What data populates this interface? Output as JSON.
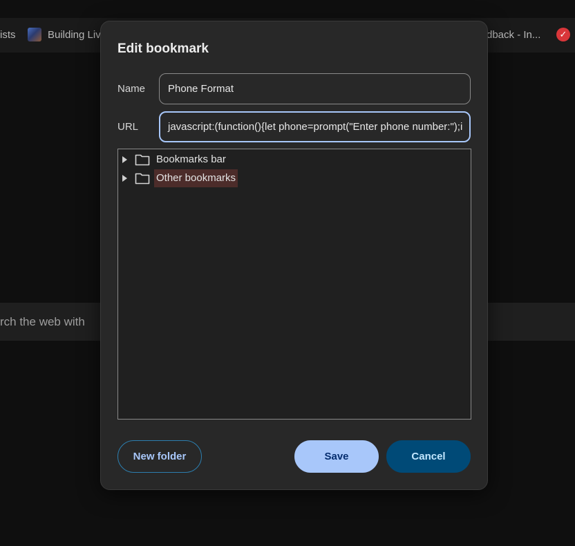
{
  "background": {
    "bookmarks_bar": {
      "items": [
        "ists",
        "Building Liv",
        "dback - In..."
      ]
    },
    "search_placeholder": "rch the web with"
  },
  "dialog": {
    "title": "Edit bookmark",
    "name_label": "Name",
    "name_value": "Phone Format",
    "url_label": "URL",
    "url_value": "javascript:(function(){let phone=prompt(\"Enter phone number:\");i",
    "folders": [
      {
        "label": "Bookmarks bar",
        "selected": false
      },
      {
        "label": "Other bookmarks",
        "selected": true
      }
    ],
    "buttons": {
      "new_folder": "New folder",
      "save": "Save",
      "cancel": "Cancel"
    }
  },
  "colors": {
    "accent": "#a8c7fa",
    "cancel_bg": "#004a77",
    "selected_folder_bg": "#4c2c2a"
  }
}
